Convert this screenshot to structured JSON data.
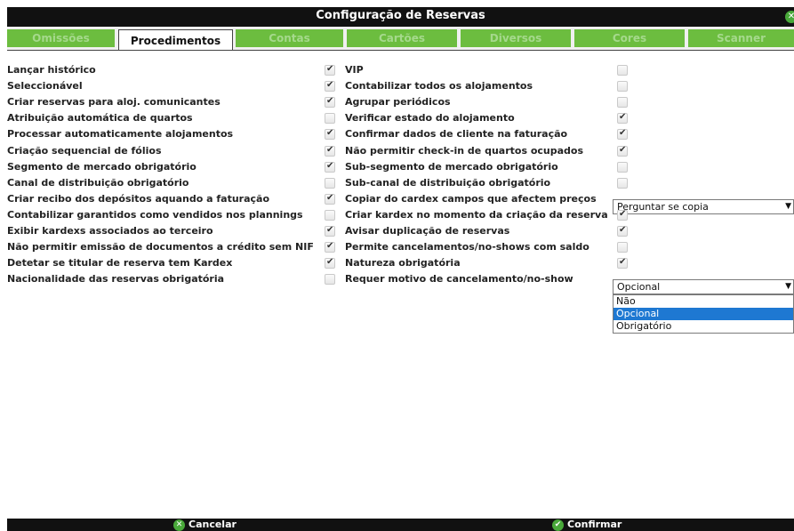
{
  "window": {
    "title": "Configuração de Reservas"
  },
  "tabs": [
    {
      "label": "Omissões",
      "active": false
    },
    {
      "label": "Procedimentos",
      "active": true
    },
    {
      "label": "Contas",
      "active": false
    },
    {
      "label": "Cartões",
      "active": false
    },
    {
      "label": "Diversos",
      "active": false
    },
    {
      "label": "Cores",
      "active": false
    },
    {
      "label": "Scanner",
      "active": false
    }
  ],
  "left_options": [
    {
      "label": "Lançar histórico",
      "checked": true
    },
    {
      "label": "Seleccionável",
      "checked": true
    },
    {
      "label": "Criar reservas para aloj. comunicantes",
      "checked": true
    },
    {
      "label": "Atribuição automática de quartos",
      "checked": false
    },
    {
      "label": "Processar automaticamente alojamentos",
      "checked": true
    },
    {
      "label": "Criação sequencial de fólios",
      "checked": true
    },
    {
      "label": "Segmento de mercado obrigatório",
      "checked": true
    },
    {
      "label": "Canal de distribuição obrigatório",
      "checked": false
    },
    {
      "label": "Criar recibo dos depósitos aquando a faturação",
      "checked": true
    },
    {
      "label": "Contabilizar garantidos como vendidos nos plannings",
      "checked": false
    },
    {
      "label": "Exibir kardexs associados ao terceiro",
      "checked": true
    },
    {
      "label": "Não permitir emissão de documentos a crédito sem NIF",
      "checked": true
    },
    {
      "label": "Detetar se titular de reserva tem Kardex",
      "checked": true
    },
    {
      "label": "Nacionalidade das reservas obrigatória",
      "checked": false
    }
  ],
  "right_options": [
    {
      "label": "VIP",
      "checked": false
    },
    {
      "label": "Contabilizar todos os alojamentos",
      "checked": false
    },
    {
      "label": "Agrupar periódicos",
      "checked": false
    },
    {
      "label": "Verificar estado do alojamento",
      "checked": true
    },
    {
      "label": "Confirmar dados de cliente na faturação",
      "checked": true
    },
    {
      "label": "Não permitir check-in de quartos ocupados",
      "checked": true
    },
    {
      "label": "Sub-segmento de mercado obrigatório",
      "checked": false
    },
    {
      "label": "Sub-canal de distribuição obrigatório",
      "checked": false
    },
    {
      "label": "Copiar do cardex campos que afectem preços",
      "checked": null
    },
    {
      "label": "Criar kardex no momento da criação da reserva",
      "checked": true
    },
    {
      "label": "Avisar duplicação de reservas",
      "checked": true
    },
    {
      "label": "Permite cancelamentos/no-shows com saldo",
      "checked": false
    },
    {
      "label": "Natureza obrigatória",
      "checked": true
    },
    {
      "label": "Requer motivo de cancelamento/no-show",
      "checked": null
    }
  ],
  "copy_select": {
    "value": "Perguntar se copia"
  },
  "motivo_select": {
    "value": "Opcional",
    "options": [
      "Não",
      "Opcional",
      "Obrigatório"
    ],
    "selected": "Opcional"
  },
  "footer": {
    "cancel_label": "Cancelar",
    "confirm_label": "Confirmar"
  },
  "colors": {
    "tab_bg": "#6cbd3f",
    "tab_text": "#a5d98c",
    "bar_bg": "#111111",
    "selected_option": "#1e78d2",
    "icon_green": "#49a93a"
  }
}
